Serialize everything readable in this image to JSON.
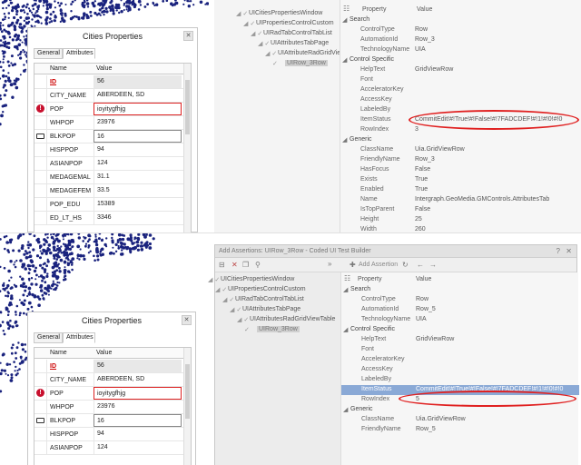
{
  "top": {
    "dialog": {
      "title": "Cities Properties",
      "close_icon": "close-icon",
      "tabs": [
        "General",
        "Attributes"
      ],
      "active_tab": "Attributes",
      "columns": {
        "name": "Name",
        "value": "Value"
      },
      "rows": [
        {
          "name": "ID",
          "value": "56"
        },
        {
          "name": "CITY_NAME",
          "value": "ABERDEEN, SD"
        },
        {
          "name": "POP",
          "value": "ioyitygfhjg"
        },
        {
          "name": "WHPOP",
          "value": "23976"
        },
        {
          "name": "BLKPOP",
          "value": "16"
        },
        {
          "name": "HISPPOP",
          "value": "94"
        },
        {
          "name": "ASIANPOP",
          "value": "124"
        },
        {
          "name": "MEDAGEMAL",
          "value": "31.1"
        },
        {
          "name": "MEDAGEFEM",
          "value": "33.5"
        },
        {
          "name": "POP_EDU",
          "value": "15389"
        },
        {
          "name": "ED_LT_HS",
          "value": "3346"
        }
      ]
    },
    "tree": [
      "UICitiesPropertiesWindow",
      "UIPropertiesControlCustom",
      "UIRadTabControlTabList",
      "UIAttributesTabPage",
      "UIAttributeRadGridView",
      "UIRow_3Row"
    ],
    "props_header": {
      "property": "Property",
      "value": "Value"
    },
    "props": [
      {
        "kind": "cat",
        "name": "Search"
      },
      {
        "kind": "prop",
        "name": "ControlType",
        "value": "Row"
      },
      {
        "kind": "prop",
        "name": "AutomationId",
        "value": "Row_3"
      },
      {
        "kind": "prop",
        "name": "TechnologyName",
        "value": "UIA"
      },
      {
        "kind": "cat",
        "name": "Control Specific"
      },
      {
        "kind": "prop",
        "name": "HelpText",
        "value": "GridViewRow"
      },
      {
        "kind": "prop",
        "name": "Font",
        "value": ""
      },
      {
        "kind": "prop",
        "name": "AcceleratorKey",
        "value": ""
      },
      {
        "kind": "prop",
        "name": "AccessKey",
        "value": ""
      },
      {
        "kind": "prop",
        "name": "LabeledBy",
        "value": ""
      },
      {
        "kind": "prop",
        "name": "ItemStatus",
        "value": "CommitEdit!#!True!#!False!#!7FADCDEF!#!1!#!0!#!0"
      },
      {
        "kind": "prop",
        "name": "RowIndex",
        "value": "3"
      },
      {
        "kind": "cat",
        "name": "Generic"
      },
      {
        "kind": "prop",
        "name": "ClassName",
        "value": "Uia.GridViewRow"
      },
      {
        "kind": "prop",
        "name": "FriendlyName",
        "value": "Row_3"
      },
      {
        "kind": "prop",
        "name": "HasFocus",
        "value": "False"
      },
      {
        "kind": "prop",
        "name": "Exists",
        "value": "True"
      },
      {
        "kind": "prop",
        "name": "Enabled",
        "value": "True"
      },
      {
        "kind": "prop",
        "name": "Name",
        "value": "Intergraph.GeoMedia.GMControls.AttributesTab"
      },
      {
        "kind": "prop",
        "name": "IsTopParent",
        "value": "False"
      },
      {
        "kind": "prop",
        "name": "Height",
        "value": "25"
      },
      {
        "kind": "prop",
        "name": "Width",
        "value": "260"
      }
    ]
  },
  "bottom": {
    "dialog": {
      "title": "Cities Properties",
      "tabs": [
        "General",
        "Attributes"
      ],
      "active_tab": "Attributes",
      "columns": {
        "name": "Name",
        "value": "Value"
      },
      "rows": [
        {
          "name": "ID",
          "value": "56"
        },
        {
          "name": "CITY_NAME",
          "value": "ABERDEEN, SD"
        },
        {
          "name": "POP",
          "value": "ioyitygfhjg"
        },
        {
          "name": "WHPOP",
          "value": "23976"
        },
        {
          "name": "BLKPOP",
          "value": "16"
        },
        {
          "name": "HISPPOP",
          "value": "94"
        },
        {
          "name": "ASIANPOP",
          "value": "124"
        }
      ]
    },
    "builder": {
      "title": "Add Assertions: UIRow_3Row - Coded UI Test Builder",
      "add_assertion_label": "Add Assertion",
      "tree": [
        "UICitiesPropertiesWindow",
        "UIPropertiesControlCustom",
        "UIRadTabControlTabList",
        "UIAttributesTabPage",
        "UIAttributesRadGridViewTable",
        "UIRow_3Row"
      ],
      "props_header": {
        "property": "Property",
        "value": "Value"
      },
      "props": [
        {
          "kind": "cat",
          "name": "Search"
        },
        {
          "kind": "prop",
          "name": "ControlType",
          "value": "Row"
        },
        {
          "kind": "prop",
          "name": "AutomationId",
          "value": "Row_5"
        },
        {
          "kind": "prop",
          "name": "TechnologyName",
          "value": "UIA"
        },
        {
          "kind": "cat",
          "name": "Control Specific"
        },
        {
          "kind": "prop",
          "name": "HelpText",
          "value": "GridViewRow"
        },
        {
          "kind": "prop",
          "name": "Font",
          "value": ""
        },
        {
          "kind": "prop",
          "name": "AcceleratorKey",
          "value": ""
        },
        {
          "kind": "prop",
          "name": "AccessKey",
          "value": ""
        },
        {
          "kind": "prop",
          "name": "LabeledBy",
          "value": ""
        },
        {
          "kind": "prop",
          "name": "ItemStatus",
          "value": "CommitEdit!#!True!#!False!#!7FADCDEF!#!1!#!0!#!0"
        },
        {
          "kind": "prop",
          "name": "RowIndex",
          "value": "5"
        },
        {
          "kind": "cat",
          "name": "Generic"
        },
        {
          "kind": "prop",
          "name": "ClassName",
          "value": "Uia.GridViewRow"
        },
        {
          "kind": "prop",
          "name": "FriendlyName",
          "value": "Row_5"
        }
      ]
    }
  },
  "colors": {
    "error": "#c8102e",
    "selection": "#8aa9d6",
    "annotation": "#e02020",
    "map_points": "#1a237e"
  }
}
